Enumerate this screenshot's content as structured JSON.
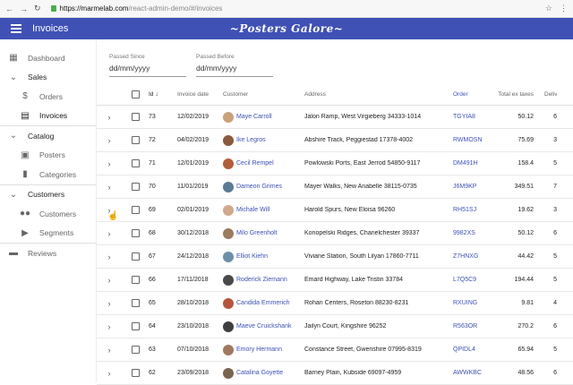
{
  "browser": {
    "back": "←",
    "forward": "→",
    "reload": "↻",
    "url_host": "https://marmelab.com",
    "url_path": "/react-admin-demo/#/invoices",
    "star": "☆",
    "menu": "⋮"
  },
  "appbar": {
    "title": "Invoices",
    "brand": "~Posters Galore~",
    "color": "#3f51b5"
  },
  "sidebar": {
    "dashboard": "Dashboard",
    "sales": "Sales",
    "orders": "Orders",
    "invoices": "Invoices",
    "catalog": "Catalog",
    "posters": "Posters",
    "categories": "Categories",
    "customers_group": "Customers",
    "customers": "Customers",
    "segments": "Segments",
    "reviews": "Reviews"
  },
  "filters": {
    "since_label": "Passed Since",
    "since_value": "dd/mm/yyyy",
    "before_label": "Passed Before",
    "before_value": "dd/mm/yyyy"
  },
  "table": {
    "headers": {
      "id": "Id",
      "date": "Invoice date",
      "customer": "Customer",
      "address": "Address",
      "order": "Order",
      "total": "Total ex taxes",
      "delivery": "Delivery fe"
    },
    "rows": [
      {
        "id": "73",
        "date": "12/02/2019",
        "customer": "Maye Carroll",
        "address": "Jalon Ramp, West Virgieberg 34333-1014",
        "order": "TGYIA8",
        "total": "50.12",
        "delivery": "6",
        "avatar": "#c9a27a"
      },
      {
        "id": "72",
        "date": "04/02/2019",
        "customer": "Ike Legros",
        "address": "Abshire Track, Peggiestad 17378-4002",
        "order": "RWMOSN",
        "total": "75.69",
        "delivery": "3",
        "avatar": "#8a5a3c"
      },
      {
        "id": "71",
        "date": "12/01/2019",
        "customer": "Cecil Rempel",
        "address": "Powlowski Ports, East Jerrod 54850-9117",
        "order": "DM491H",
        "total": "158.4",
        "delivery": "5",
        "avatar": "#b05f3a"
      },
      {
        "id": "70",
        "date": "11/01/2019",
        "customer": "Dameon Grimes",
        "address": "Mayer Walks, New Anabelle 38115-0735",
        "order": "J6M9KP",
        "total": "349.51",
        "delivery": "7",
        "avatar": "#5b7a93"
      },
      {
        "id": "69",
        "date": "02/01/2019",
        "customer": "Michale Will",
        "address": "Harold Spurs, New Eloisa 96260",
        "order": "RH51SJ",
        "total": "19.62",
        "delivery": "3",
        "avatar": "#d0a88c"
      },
      {
        "id": "68",
        "date": "30/12/2018",
        "customer": "Milo Greenholt",
        "address": "Konopelski Ridges, Chanelchester 39337",
        "order": "9982XS",
        "total": "50.12",
        "delivery": "6",
        "avatar": "#9c7b5e"
      },
      {
        "id": "67",
        "date": "24/12/2018",
        "customer": "Elliot Kiehn",
        "address": "Viviane Station, South Lilyan 17860-7711",
        "order": "Z7HNXG",
        "total": "44.42",
        "delivery": "5",
        "avatar": "#6d8fa8"
      },
      {
        "id": "66",
        "date": "17/11/2018",
        "customer": "Roderick Ziemann",
        "address": "Emard Highway, Lake Tristin 33784",
        "order": "L7Q5C9",
        "total": "194.44",
        "delivery": "5",
        "avatar": "#4a4a4a"
      },
      {
        "id": "65",
        "date": "28/10/2018",
        "customer": "Candida Emmerich",
        "address": "Rohan Centers, Roseton 88230-8231",
        "order": "RXUING",
        "total": "9.81",
        "delivery": "4",
        "avatar": "#b5553e"
      },
      {
        "id": "64",
        "date": "23/10/2018",
        "customer": "Maeve Cruickshank",
        "address": "Jailyn Court, Kingshire 96252",
        "order": "R563OR",
        "total": "270.2",
        "delivery": "6",
        "avatar": "#3f3f3f"
      },
      {
        "id": "63",
        "date": "07/10/2018",
        "customer": "Emory Hermann",
        "address": "Constance Street, Gwenshire 07995-8319",
        "order": "QPIDL4",
        "total": "65.94",
        "delivery": "5",
        "avatar": "#a07860"
      },
      {
        "id": "62",
        "date": "23/09/2018",
        "customer": "Catalina Goyette",
        "address": "Barney Plain, Kubside 69097-4959",
        "order": "AWWKBC",
        "total": "48.56",
        "delivery": "6",
        "avatar": "#7a6450"
      }
    ]
  }
}
